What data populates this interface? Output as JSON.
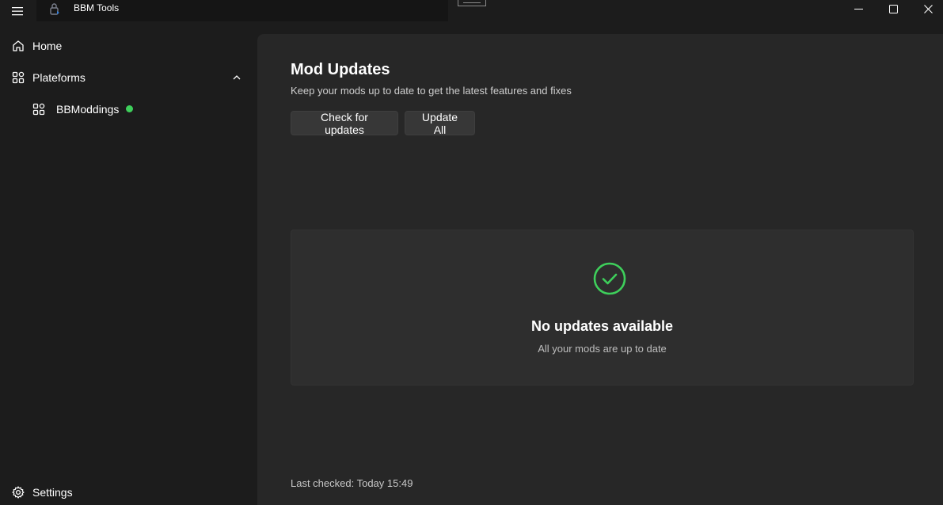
{
  "window": {
    "title": "BBM Tools"
  },
  "sidebar": {
    "items": [
      {
        "label": "Home",
        "icon": "home-icon"
      },
      {
        "label": "Plateforms",
        "icon": "apps-icon",
        "expanded": true
      },
      {
        "label": "BBModdings",
        "icon": "apps-icon",
        "status_color": "#3ecf5b"
      }
    ],
    "footer": {
      "label": "Settings",
      "icon": "gear-icon"
    }
  },
  "main": {
    "title": "Mod Updates",
    "subtitle": "Keep your mods up to date to get the latest features and fixes",
    "buttons": {
      "check_label": "Check for updates",
      "update_all_label": "Update All"
    },
    "status": {
      "icon": "check-circle-icon",
      "icon_color": "#3ecf5b",
      "title": "No updates available",
      "subtitle": "All your mods are up to date"
    },
    "last_checked": "Last checked: Today 15:49"
  }
}
